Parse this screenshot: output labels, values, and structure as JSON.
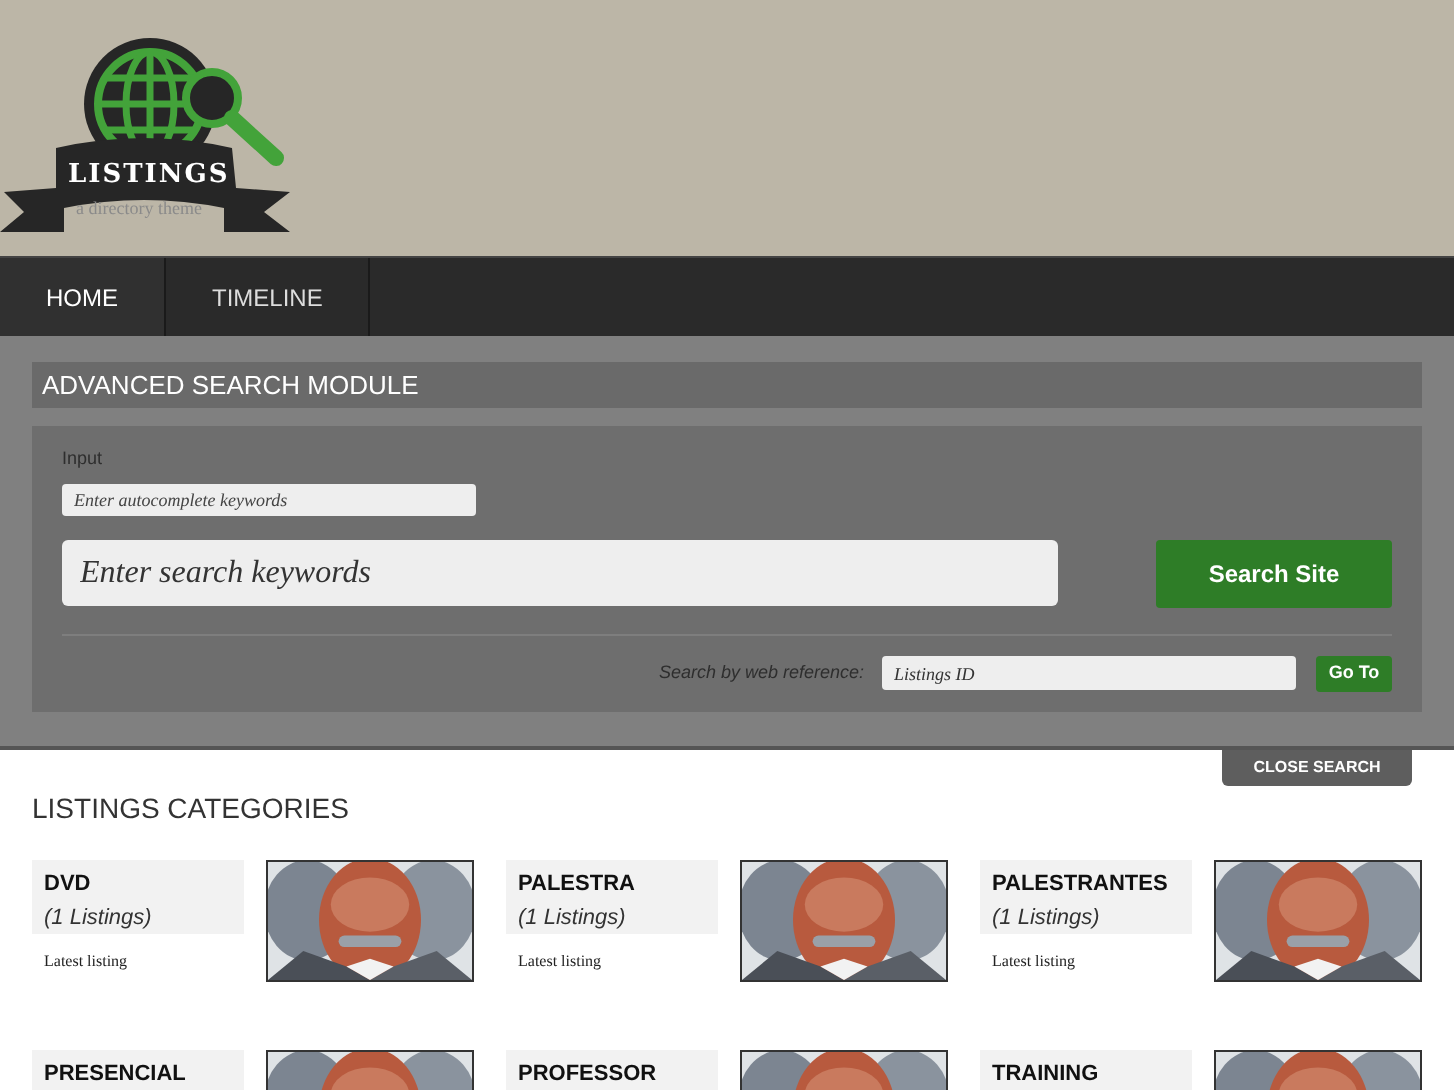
{
  "logo": {
    "name": "LISTINGS",
    "tagline": "a directory theme"
  },
  "nav": [
    {
      "label": "HOME",
      "selected": true
    },
    {
      "label": "TIMELINE",
      "selected": false
    }
  ],
  "search": {
    "title": "ADVANCED SEARCH MODULE",
    "input_label": "Input",
    "autocomplete_placeholder": "Enter autocomplete keywords",
    "keywords_placeholder": "Enter search keywords",
    "search_button": "Search Site",
    "reference_label": "Search by web reference:",
    "reference_placeholder": "Listings ID",
    "goto_button": "Go To",
    "close_button": "CLOSE SEARCH"
  },
  "categories": {
    "title": "LISTINGS CATEGORIES",
    "items": [
      {
        "name": "DVD",
        "count": "(1 Listings)",
        "latest": "Latest listing"
      },
      {
        "name": "PALESTRA",
        "count": "(1 Listings)",
        "latest": "Latest listing"
      },
      {
        "name": "PALESTRANTES",
        "count": "(1 Listings)",
        "latest": "Latest listing"
      },
      {
        "name": "PRESENCIAL"
      },
      {
        "name": "PROFESSOR"
      },
      {
        "name": "TRAINING"
      }
    ]
  }
}
